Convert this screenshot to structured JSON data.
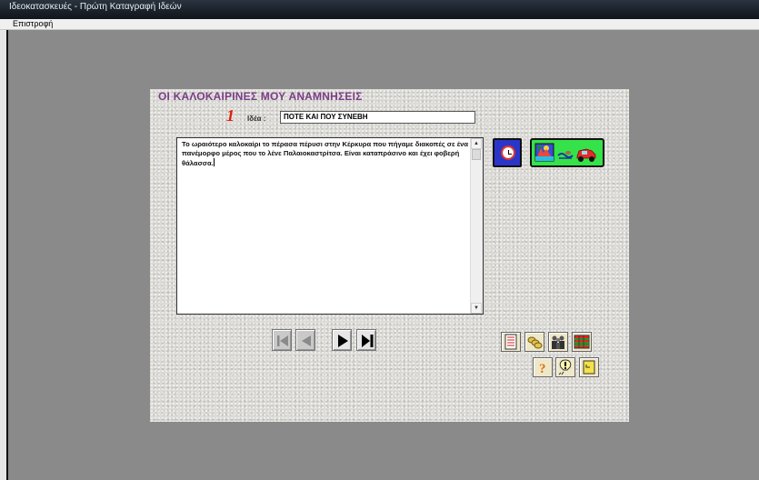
{
  "window": {
    "title": "Ιδεοκατασκευές - Πρώτη Καταγραφή Ιδεών"
  },
  "menu": {
    "items": [
      {
        "label": "Επιστροφή"
      }
    ]
  },
  "panel": {
    "title": "ΟΙ ΚΑΛΟΚΑΙΡΙΝΕΣ ΜΟΥ ΑΝΑΜΝΗΣΕΙΣ",
    "idea_number": "1",
    "idea_label": "Ιδέα :",
    "idea_value": "ΠΟΤΕ ΚΑΙ ΠΟΥ ΣΥΝΕΒΗ",
    "body_text": "Το ωραιότερο καλοκαίρι το πέρασα πέρυσι στην Κέρκυρα που πήγαμε διακοπές σε ένα πανέμορφο μέρος που το λένε Παλαιοκαστρίτσα. Είναι καταπράσινο και έχει φοβερή θάλασσα."
  },
  "colors": {
    "title_purple": "#7a3d86",
    "number_red": "#dd1e10",
    "clock_blue": "#2a36c8",
    "vacation_green": "#35e24a",
    "panel_bg": "#dcdbd7",
    "workspace_gray": "#8a8a8a"
  },
  "icons": {
    "clock": "clock-icon",
    "vacation": "vacation-scene-icon",
    "nav": [
      "first-record-icon",
      "previous-record-icon",
      "next-record-icon",
      "last-record-icon"
    ],
    "tools": [
      "list-icon",
      "coins-icon",
      "people-icon",
      "grid-icon",
      "question-icon",
      "exclamation-bulb-icon",
      "note-icon"
    ]
  }
}
